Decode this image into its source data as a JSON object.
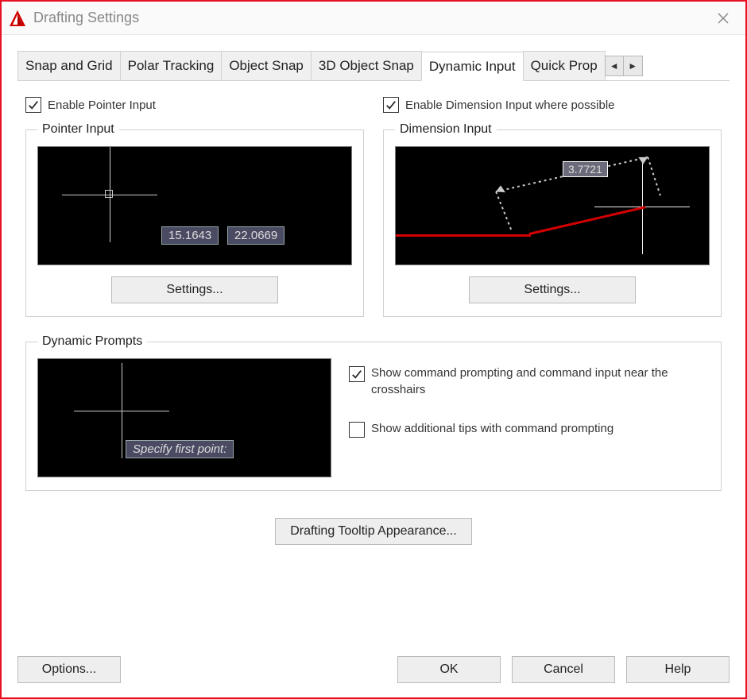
{
  "window": {
    "title": "Drafting Settings"
  },
  "tabs": {
    "items": [
      "Snap and Grid",
      "Polar Tracking",
      "Object Snap",
      "3D Object Snap",
      "Dynamic Input",
      "Quick Prop"
    ],
    "active_index": 4
  },
  "pointer_input": {
    "enable_label": "Enable Pointer Input",
    "enable_checked": true,
    "legend": "Pointer Input",
    "coord_x": "15.1643",
    "coord_y": "22.0669",
    "settings_btn": "Settings..."
  },
  "dimension_input": {
    "enable_label": "Enable Dimension Input where possible",
    "enable_checked": true,
    "legend": "Dimension Input",
    "value": "3.7721",
    "settings_btn": "Settings..."
  },
  "dynamic_prompts": {
    "legend": "Dynamic Prompts",
    "prompt_text": "Specify first point:",
    "show_command_prompting_label": "Show command prompting and command input near the crosshairs",
    "show_command_prompting_checked": true,
    "show_additional_tips_label": "Show additional tips with command prompting",
    "show_additional_tips_checked": false
  },
  "tooltip_appearance_btn": "Drafting Tooltip Appearance...",
  "footer": {
    "options": "Options...",
    "ok": "OK",
    "cancel": "Cancel",
    "help": "Help"
  }
}
